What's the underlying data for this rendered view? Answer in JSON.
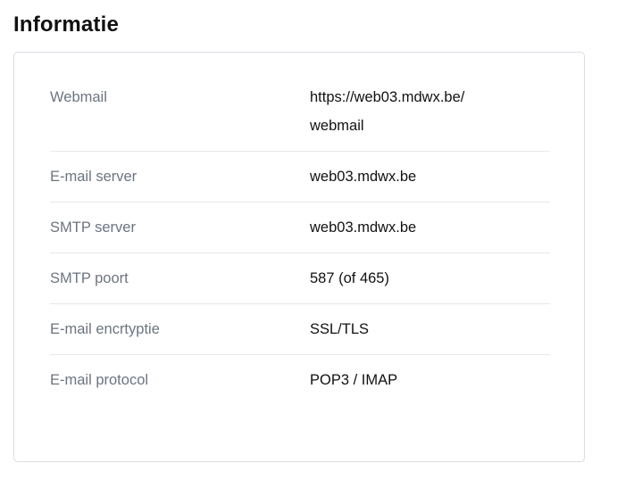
{
  "heading": "Informatie",
  "rows": [
    {
      "label": "Webmail",
      "value": "https://web03.mdwx.be/ webmail"
    },
    {
      "label": "E-mail server",
      "value": "web03.mdwx.be"
    },
    {
      "label": "SMTP server",
      "value": "web03.mdwx.be"
    },
    {
      "label": "SMTP poort",
      "value": "587 (of 465)"
    },
    {
      "label": "E-mail encrtyptie",
      "value": "SSL/TLS"
    },
    {
      "label": "E-mail protocol",
      "value": "POP3 / IMAP"
    }
  ]
}
